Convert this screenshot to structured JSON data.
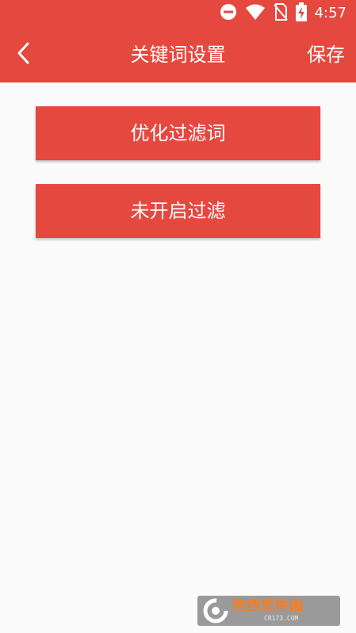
{
  "status_bar": {
    "time": "4:57",
    "icons": [
      "dnd-icon",
      "wifi-icon",
      "no-sim-icon",
      "battery-charging-icon"
    ]
  },
  "toolbar": {
    "title": "关键词设置",
    "save_label": "保存",
    "back_icon": "chevron-left-icon"
  },
  "buttons": [
    {
      "label": "优化过滤词"
    },
    {
      "label": "未开启过滤"
    }
  ],
  "watermark": {
    "brand": "西西软件园",
    "url": "CR173.COM"
  },
  "colors": {
    "accent": "#e5483f",
    "background": "#fafafa"
  }
}
